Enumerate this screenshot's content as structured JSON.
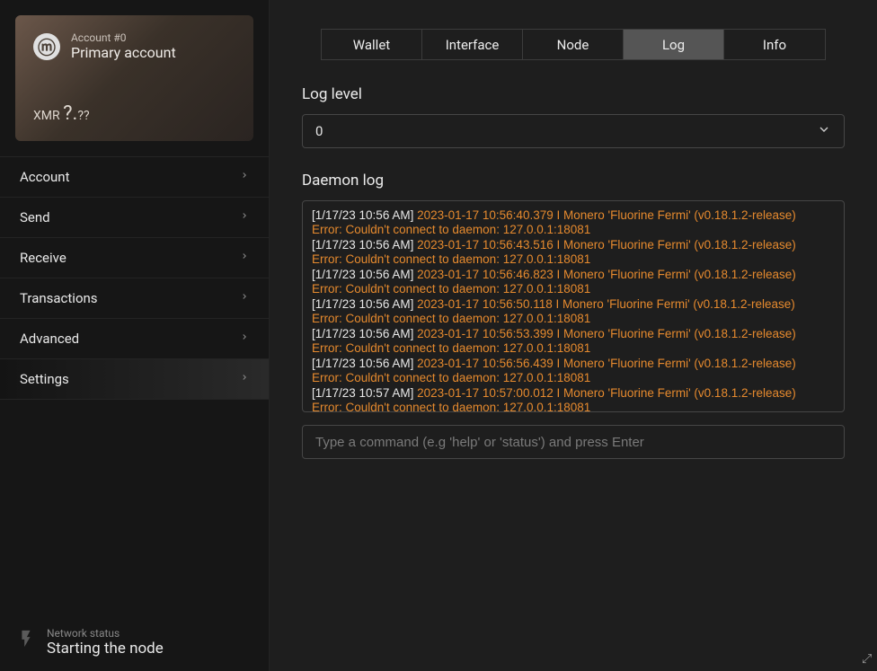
{
  "account": {
    "number": "Account #0",
    "name": "Primary account",
    "currency": "XMR",
    "balance_main": "?.",
    "balance_dec": "??"
  },
  "nav": {
    "items": [
      {
        "label": "Account"
      },
      {
        "label": "Send"
      },
      {
        "label": "Receive"
      },
      {
        "label": "Transactions"
      },
      {
        "label": "Advanced"
      },
      {
        "label": "Settings"
      }
    ],
    "active_index": 5
  },
  "network": {
    "label": "Network status",
    "status": "Starting the node"
  },
  "tabs": {
    "items": [
      "Wallet",
      "Interface",
      "Node",
      "Log",
      "Info"
    ],
    "active_index": 3
  },
  "log_level": {
    "label": "Log level",
    "value": "0"
  },
  "daemon_log": {
    "label": "Daemon log",
    "entries": [
      {
        "ts": "[1/17/23 10:56 AM]",
        "info": "2023-01-17 10:56:40.379 I Monero 'Fluorine Fermi' (v0.18.1.2-release)",
        "err": "Error: Couldn't connect to daemon: 127.0.0.1:18081"
      },
      {
        "ts": "[1/17/23 10:56 AM]",
        "info": "2023-01-17 10:56:43.516 I Monero 'Fluorine Fermi' (v0.18.1.2-release)",
        "err": "Error: Couldn't connect to daemon: 127.0.0.1:18081"
      },
      {
        "ts": "[1/17/23 10:56 AM]",
        "info": "2023-01-17 10:56:46.823 I Monero 'Fluorine Fermi' (v0.18.1.2-release)",
        "err": "Error: Couldn't connect to daemon: 127.0.0.1:18081"
      },
      {
        "ts": "[1/17/23 10:56 AM]",
        "info": "2023-01-17 10:56:50.118 I Monero 'Fluorine Fermi' (v0.18.1.2-release)",
        "err": "Error: Couldn't connect to daemon: 127.0.0.1:18081"
      },
      {
        "ts": "[1/17/23 10:56 AM]",
        "info": "2023-01-17 10:56:53.399 I Monero 'Fluorine Fermi' (v0.18.1.2-release)",
        "err": "Error: Couldn't connect to daemon: 127.0.0.1:18081"
      },
      {
        "ts": "[1/17/23 10:56 AM]",
        "info": "2023-01-17 10:56:56.439 I Monero 'Fluorine Fermi' (v0.18.1.2-release)",
        "err": "Error: Couldn't connect to daemon: 127.0.0.1:18081"
      },
      {
        "ts": "[1/17/23 10:57 AM]",
        "info": "2023-01-17 10:57:00.012 I Monero 'Fluorine Fermi' (v0.18.1.2-release)",
        "err": "Error: Couldn't connect to daemon: 127.0.0.1:18081"
      }
    ]
  },
  "command_input": {
    "placeholder": "Type a command (e.g 'help' or 'status') and press Enter"
  }
}
